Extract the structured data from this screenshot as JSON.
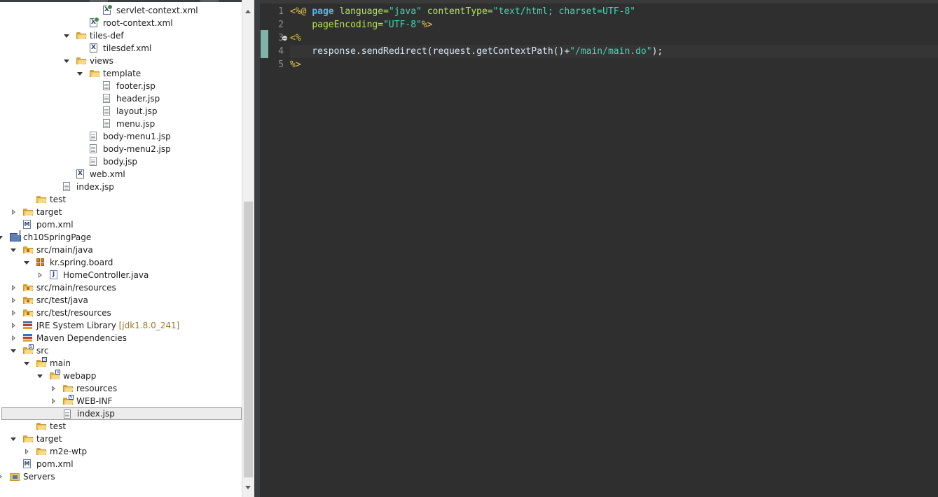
{
  "explorer": {
    "rows": [
      {
        "label": "servlet-context.xml",
        "icon": "spring-xml-file-icon",
        "twisty": "none",
        "depth": 8
      },
      {
        "label": "root-context.xml",
        "icon": "spring-xml-file-icon",
        "twisty": "none",
        "depth": 7
      },
      {
        "label": "tiles-def",
        "icon": "folder-icon",
        "twisty": "expanded",
        "depth": 6
      },
      {
        "label": "tilesdef.xml",
        "icon": "xml-file-icon",
        "twisty": "none",
        "depth": 7
      },
      {
        "label": "views",
        "icon": "folder-icon",
        "twisty": "expanded",
        "depth": 6
      },
      {
        "label": "template",
        "icon": "folder-icon",
        "twisty": "expanded",
        "depth": 7
      },
      {
        "label": "footer.jsp",
        "icon": "jsp-file-icon",
        "twisty": "none",
        "depth": 8
      },
      {
        "label": "header.jsp",
        "icon": "jsp-file-icon",
        "twisty": "none",
        "depth": 8
      },
      {
        "label": "layout.jsp",
        "icon": "jsp-file-icon",
        "twisty": "none",
        "depth": 8
      },
      {
        "label": "menu.jsp",
        "icon": "jsp-file-icon",
        "twisty": "none",
        "depth": 8
      },
      {
        "label": "body-menu1.jsp",
        "icon": "jsp-file-icon",
        "twisty": "none",
        "depth": 7
      },
      {
        "label": "body-menu2.jsp",
        "icon": "jsp-file-icon",
        "twisty": "none",
        "depth": 7
      },
      {
        "label": "body.jsp",
        "icon": "jsp-file-icon",
        "twisty": "none",
        "depth": 7
      },
      {
        "label": "web.xml",
        "icon": "xml-file-icon",
        "twisty": "none",
        "depth": 6
      },
      {
        "label": "index.jsp",
        "icon": "jsp-file-icon",
        "twisty": "none",
        "depth": 5
      },
      {
        "label": "test",
        "icon": "folder-icon",
        "twisty": "none",
        "depth": 3
      },
      {
        "label": "target",
        "icon": "folder-icon",
        "twisty": "collapsed",
        "depth": 2
      },
      {
        "label": "pom.xml",
        "icon": "maven-pom-icon",
        "twisty": "none",
        "depth": 2
      },
      {
        "label": "ch10SpringPage",
        "icon": "java-project-icon",
        "twisty": "expanded",
        "depth": 1
      },
      {
        "label": "src/main/java",
        "icon": "source-folder-icon",
        "twisty": "expanded",
        "depth": 2
      },
      {
        "label": "kr.spring.board",
        "icon": "package-icon",
        "twisty": "expanded",
        "depth": 3
      },
      {
        "label": "HomeController.java",
        "icon": "java-file-icon",
        "twisty": "collapsed",
        "depth": 4
      },
      {
        "label": "src/main/resources",
        "icon": "source-folder-icon",
        "twisty": "collapsed",
        "depth": 2
      },
      {
        "label": "src/test/java",
        "icon": "source-folder-icon",
        "twisty": "collapsed",
        "depth": 2
      },
      {
        "label": "src/test/resources",
        "icon": "source-folder-icon",
        "twisty": "collapsed",
        "depth": 2
      },
      {
        "label": "JRE System Library",
        "decoration": "[jdk1.8.0_241]",
        "icon": "library-icon",
        "twisty": "collapsed",
        "depth": 2
      },
      {
        "label": "Maven Dependencies",
        "icon": "library-icon",
        "twisty": "collapsed",
        "depth": 2
      },
      {
        "label": "src",
        "icon": "folder-icon",
        "overlay": true,
        "twisty": "expanded",
        "depth": 2
      },
      {
        "label": "main",
        "icon": "folder-icon",
        "overlay": true,
        "twisty": "expanded",
        "depth": 3
      },
      {
        "label": "webapp",
        "icon": "folder-icon",
        "overlay": true,
        "twisty": "expanded",
        "depth": 4
      },
      {
        "label": "resources",
        "icon": "folder-icon",
        "twisty": "collapsed",
        "depth": 5
      },
      {
        "label": "WEB-INF",
        "icon": "folder-icon",
        "overlay": true,
        "twisty": "collapsed",
        "depth": 5
      },
      {
        "label": "index.jsp",
        "icon": "jsp-file-icon",
        "twisty": "none",
        "depth": 5,
        "selected": true
      },
      {
        "label": "test",
        "icon": "folder-icon",
        "twisty": "none",
        "depth": 3
      },
      {
        "label": "target",
        "icon": "folder-icon",
        "twisty": "expanded",
        "depth": 2
      },
      {
        "label": "m2e-wtp",
        "icon": "folder-icon",
        "twisty": "collapsed",
        "depth": 3
      },
      {
        "label": "pom.xml",
        "icon": "maven-pom-icon",
        "twisty": "none",
        "depth": 2
      },
      {
        "label": "Servers",
        "icon": "servers-folder-icon",
        "twisty": "collapsed",
        "depth": 1
      }
    ]
  },
  "editor": {
    "lines": [
      {
        "number": "1",
        "tokens": [
          {
            "t": "<%@ ",
            "c": "delim"
          },
          {
            "t": "page",
            "c": "kw"
          },
          {
            "t": " ",
            "c": "plain"
          },
          {
            "t": "language=",
            "c": "attr"
          },
          {
            "t": "\"java\"",
            "c": "str"
          },
          {
            "t": " ",
            "c": "plain"
          },
          {
            "t": "contentType=",
            "c": "attr"
          },
          {
            "t": "\"text/html; charset=UTF-8\"",
            "c": "str"
          }
        ]
      },
      {
        "number": "2",
        "tokens": [
          {
            "t": "    ",
            "c": "plain"
          },
          {
            "t": "pageEncoding=",
            "c": "attr"
          },
          {
            "t": "\"UTF-8\"",
            "c": "str"
          },
          {
            "t": "%>",
            "c": "delim"
          }
        ]
      },
      {
        "number": "3",
        "fold": true,
        "tokens": [
          {
            "t": "<%",
            "c": "delim"
          }
        ]
      },
      {
        "number": "4",
        "current": true,
        "tokens": [
          {
            "t": "    response.sendRedirect(request.getContextPath()+",
            "c": "plain"
          },
          {
            "t": "\"/main/main.do\"",
            "c": "str"
          },
          {
            "t": ");",
            "c": "plain"
          }
        ]
      },
      {
        "number": "5",
        "tokens": [
          {
            "t": "%>",
            "c": "delim"
          }
        ]
      }
    ]
  },
  "colors": {
    "editor_background": "#2f2f2f",
    "explorer_background": "#ffffff",
    "jsp_delimiter": "#e6c84c",
    "keyword": "#54b5f0",
    "attribute": "#b6e64f",
    "string": "#3dd9b5",
    "selection_border": "#9c9c9c"
  }
}
